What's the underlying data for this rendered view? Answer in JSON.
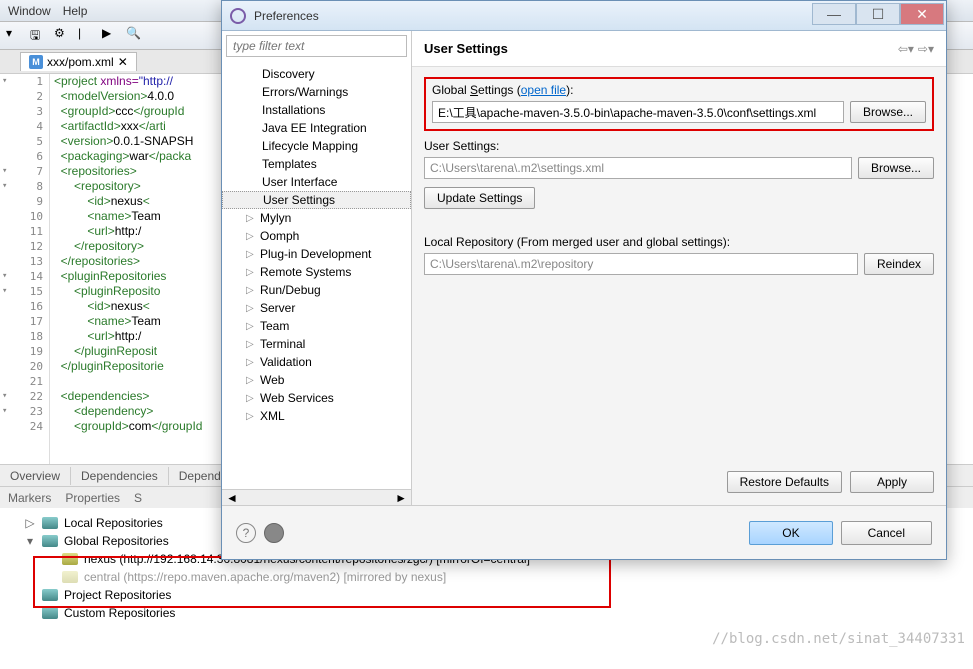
{
  "menubar": {
    "window": "Window",
    "help": "Help"
  },
  "editor": {
    "tab": "xxx/pom.xml",
    "lines": [
      {
        "n": 1,
        "html": "<span class='tag'>&lt;project</span> <span class='attr'>xmlns=</span><span class='str'>\"http://</span>"
      },
      {
        "n": 2,
        "html": "  <span class='tag'>&lt;modelVersion&gt;</span>4.0.0"
      },
      {
        "n": 3,
        "html": "  <span class='tag'>&lt;groupId&gt;</span><span class='txt'>ccc</span><span class='tag'>&lt;/groupId</span>"
      },
      {
        "n": 4,
        "html": "  <span class='tag'>&lt;artifactId&gt;</span><span class='txt'>xxx</span><span class='tag'>&lt;/arti</span>"
      },
      {
        "n": 5,
        "html": "  <span class='tag'>&lt;version&gt;</span>0.0.1-SNAPSH"
      },
      {
        "n": 6,
        "html": "  <span class='tag'>&lt;packaging&gt;</span>war<span class='tag'>&lt;/packa</span>"
      },
      {
        "n": 7,
        "html": "  <span class='tag'>&lt;repositories&gt;</span>"
      },
      {
        "n": 8,
        "html": "      <span class='tag'>&lt;repository&gt;</span>"
      },
      {
        "n": 9,
        "html": "          <span class='tag'>&lt;id&gt;</span>nexus<span class='tag'>&lt;</span>"
      },
      {
        "n": 10,
        "html": "          <span class='tag'>&lt;name&gt;</span>Team"
      },
      {
        "n": 11,
        "html": "          <span class='tag'>&lt;url&gt;</span>http:/"
      },
      {
        "n": 12,
        "html": "      <span class='tag'>&lt;/repository&gt;</span>"
      },
      {
        "n": 13,
        "html": "  <span class='tag'>&lt;/repositories&gt;</span>"
      },
      {
        "n": 14,
        "html": "  <span class='tag'>&lt;pluginRepositories</span>"
      },
      {
        "n": 15,
        "html": "      <span class='tag'>&lt;pluginReposito</span>"
      },
      {
        "n": 16,
        "html": "          <span class='tag'>&lt;id&gt;</span>nexus<span class='tag'>&lt;</span>"
      },
      {
        "n": 17,
        "html": "          <span class='tag'>&lt;name&gt;</span>Team"
      },
      {
        "n": 18,
        "html": "          <span class='tag'>&lt;url&gt;</span>http:/"
      },
      {
        "n": 19,
        "html": "      <span class='tag'>&lt;/pluginReposit</span>"
      },
      {
        "n": 20,
        "html": "  <span class='tag'>&lt;/pluginRepositorie</span>"
      },
      {
        "n": 21,
        "html": ""
      },
      {
        "n": 22,
        "html": "  <span class='tag'>&lt;dependencies&gt;</span>"
      },
      {
        "n": 23,
        "html": "      <span class='tag'>&lt;dependency&gt;</span>"
      },
      {
        "n": 24,
        "html": "      <span class='tag'>&lt;groupId&gt;</span><span class='txt'>com</span><span class='tag'>&lt;/groupId</span>"
      }
    ],
    "bottom_tabs": [
      "Overview",
      "Dependencies",
      "Depend"
    ]
  },
  "markers_bar": [
    "Markers",
    "Properties",
    "S"
  ],
  "repos": {
    "local": "Local Repositories",
    "global": "Global Repositories",
    "nexus": "nexus (http://192.168.14.36:8081/nexus/content/repositories/zgc/) [mirrorOf=central]",
    "central": "central (https://repo.maven.apache.org/maven2) [mirrored by nexus]",
    "project": "Project Repositories",
    "custom": "Custom Repositories"
  },
  "dialog": {
    "title": "Preferences",
    "filter_placeholder": "type filter text",
    "tree": [
      "Discovery",
      "Errors/Warnings",
      "Installations",
      "Java EE Integration",
      "Lifecycle Mapping",
      "Templates",
      "User Interface",
      "User Settings"
    ],
    "tree2": [
      "Mylyn",
      "Oomph",
      "Plug-in Development",
      "Remote Systems",
      "Run/Debug",
      "Server",
      "Team",
      "Terminal",
      "Validation",
      "Web",
      "Web Services",
      "XML"
    ],
    "header": "User Settings",
    "global_label_pre": "Global ",
    "global_label_u": "S",
    "global_label_post": "ettings (",
    "open_file": "open file",
    "global_label_end": "):",
    "global_value": "E:\\工具\\apache-maven-3.5.0-bin\\apache-maven-3.5.0\\conf\\settings.xml",
    "browse": "Browse...",
    "user_label": "User Settings:",
    "user_value": "C:\\Users\\tarena\\.m2\\settings.xml",
    "update": "Update Settings",
    "local_repo_label": "Local Repository (From merged user and global settings):",
    "local_repo_value": "C:\\Users\\tarena\\.m2\\repository",
    "reindex": "Reindex",
    "restore": "Restore Defaults",
    "apply": "Apply",
    "ok": "OK",
    "cancel": "Cancel"
  },
  "watermark": "//blog.csdn.net/sinat_34407331"
}
